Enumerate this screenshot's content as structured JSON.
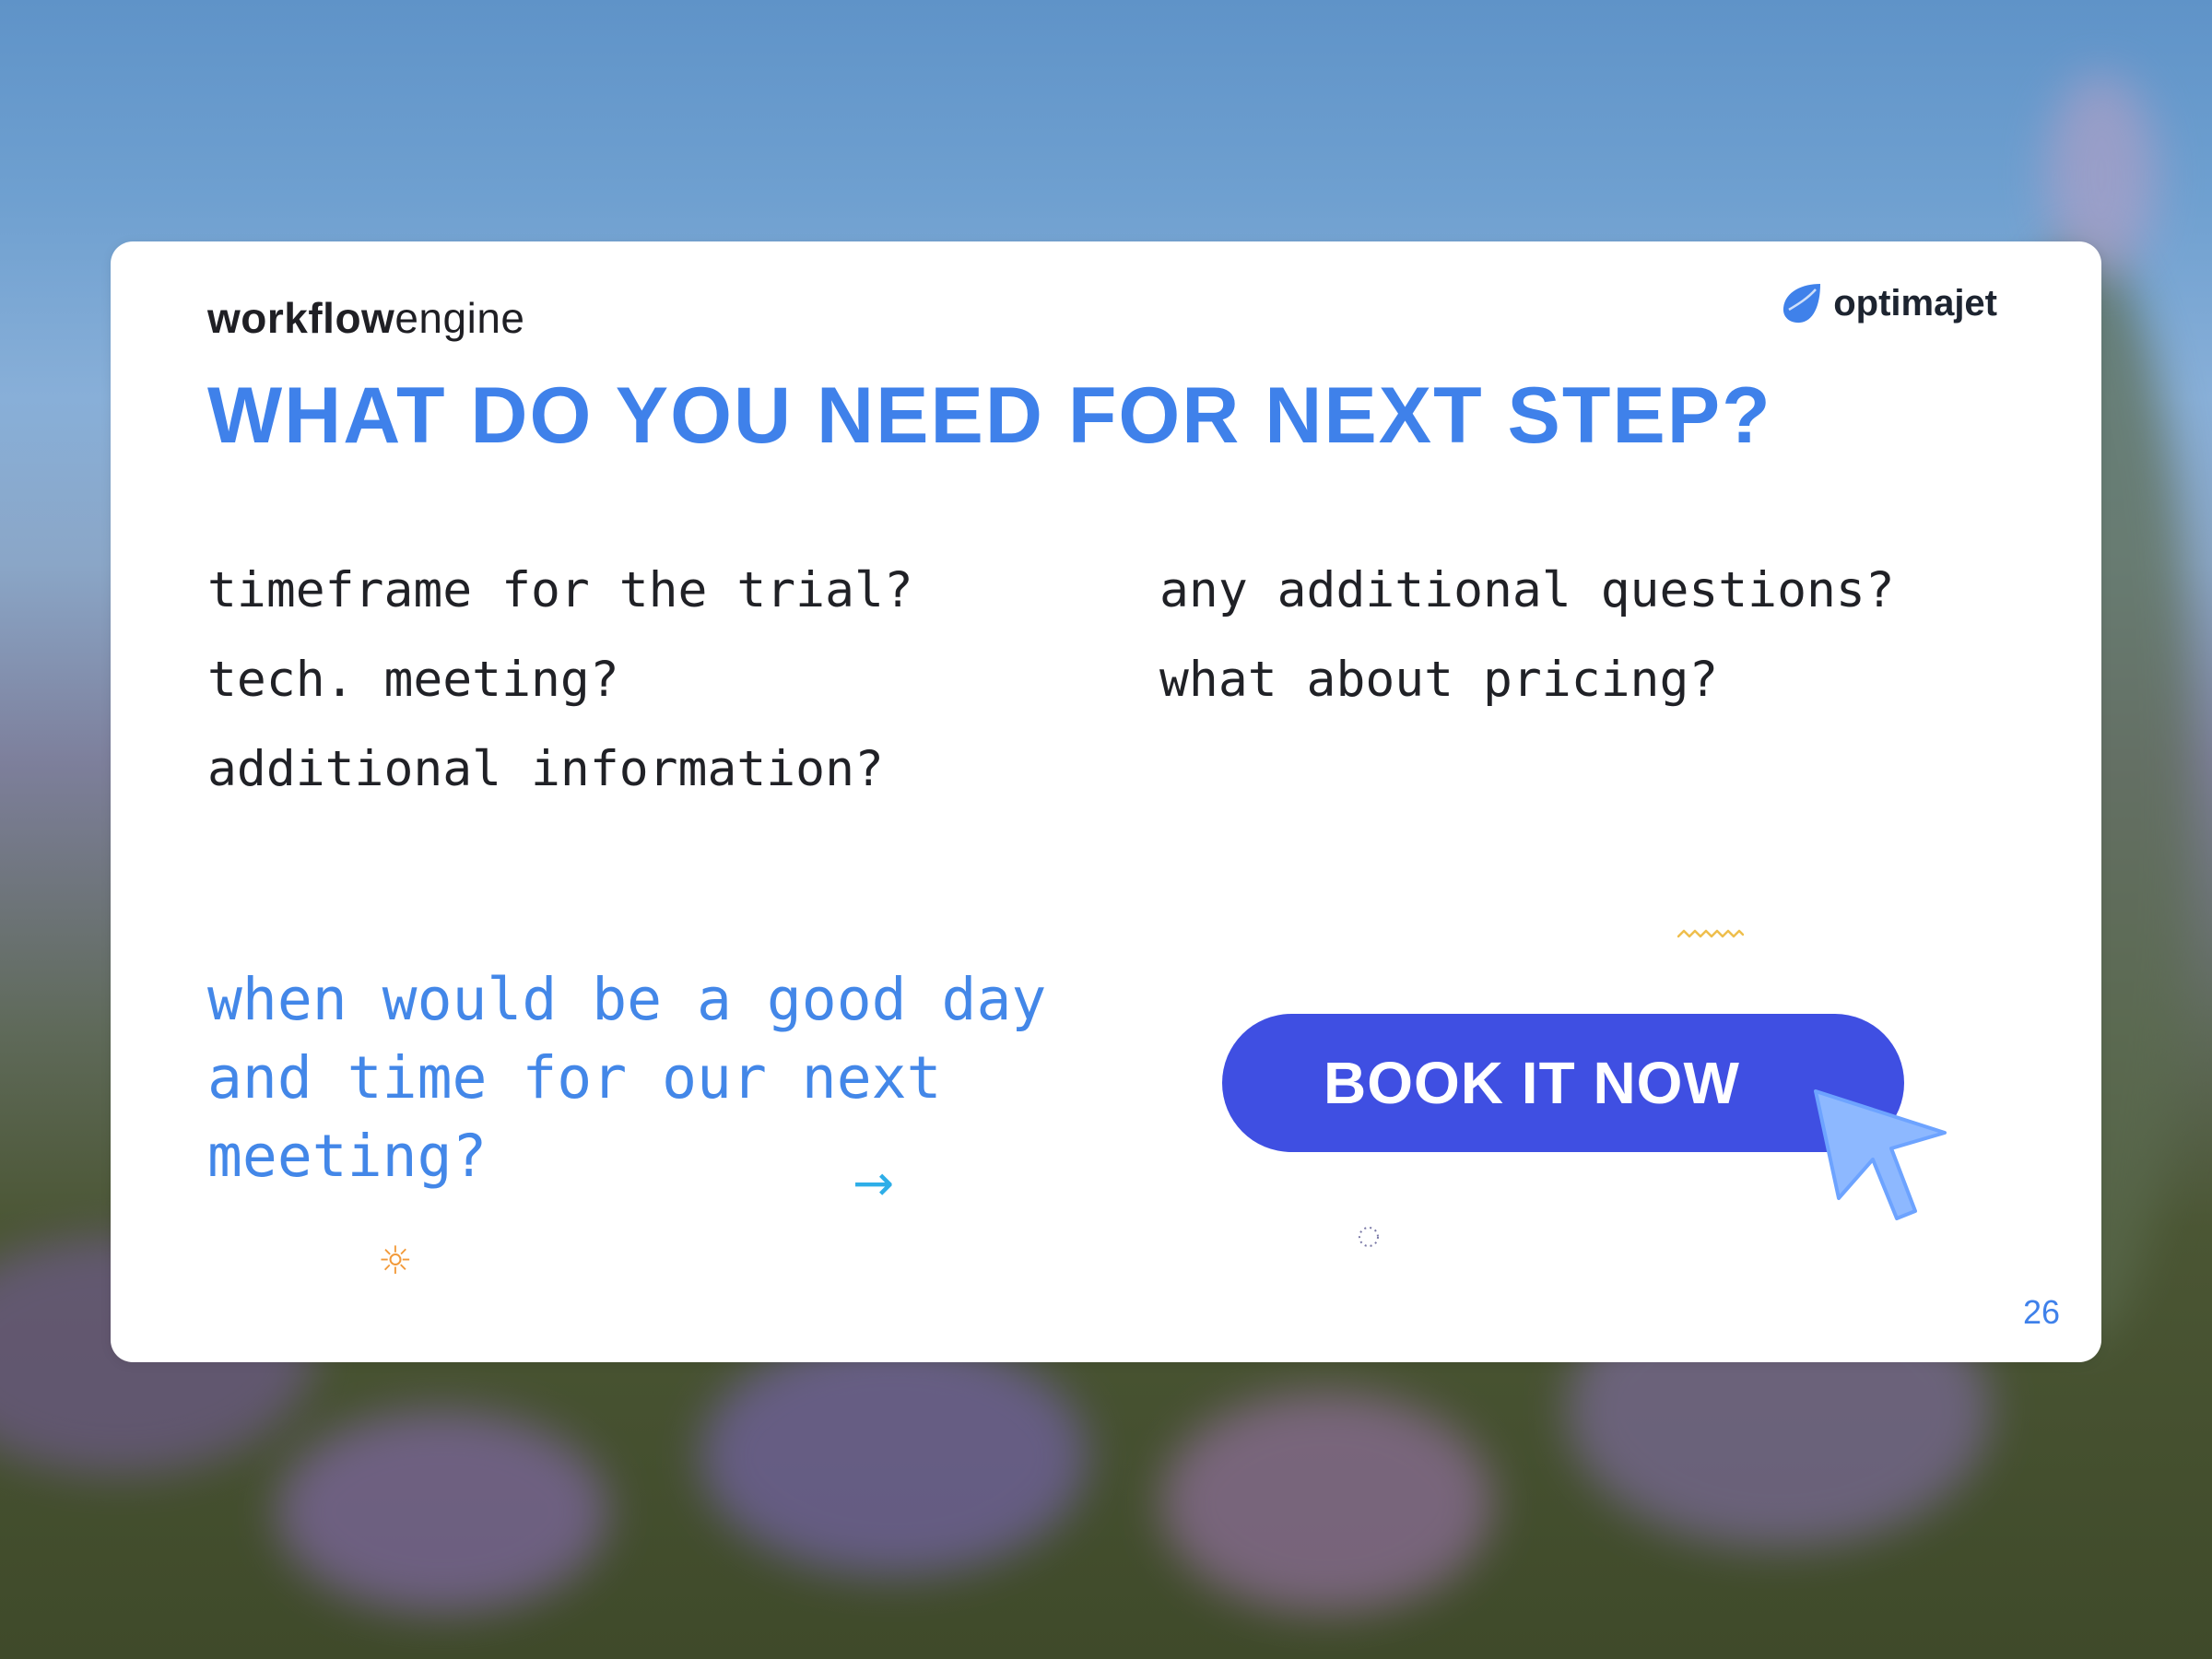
{
  "slide": {
    "brand_left": {
      "bold": "workflow",
      "regular": "engine"
    },
    "brand_right": {
      "text": "optimajet",
      "logo_icon": "leaf-drop-icon",
      "logo_color": "#3f81ea"
    },
    "title": "WHAT DO YOU NEED FOR NEXT STEP?",
    "questions_left": [
      "timeframe for the trial?",
      "tech. meeting?",
      "additional information?"
    ],
    "questions_right": [
      "any additional questions?",
      "what about pricing?"
    ],
    "invite_text": "when would be a good day and time for our next meeting?",
    "cta": {
      "label": "BOOK IT NOW",
      "background": "#3f4fe2"
    },
    "decorations": {
      "arrow_icon": "→",
      "sun_icon": "☼"
    },
    "page_number": "26",
    "accent_color": "#3f81ea"
  }
}
